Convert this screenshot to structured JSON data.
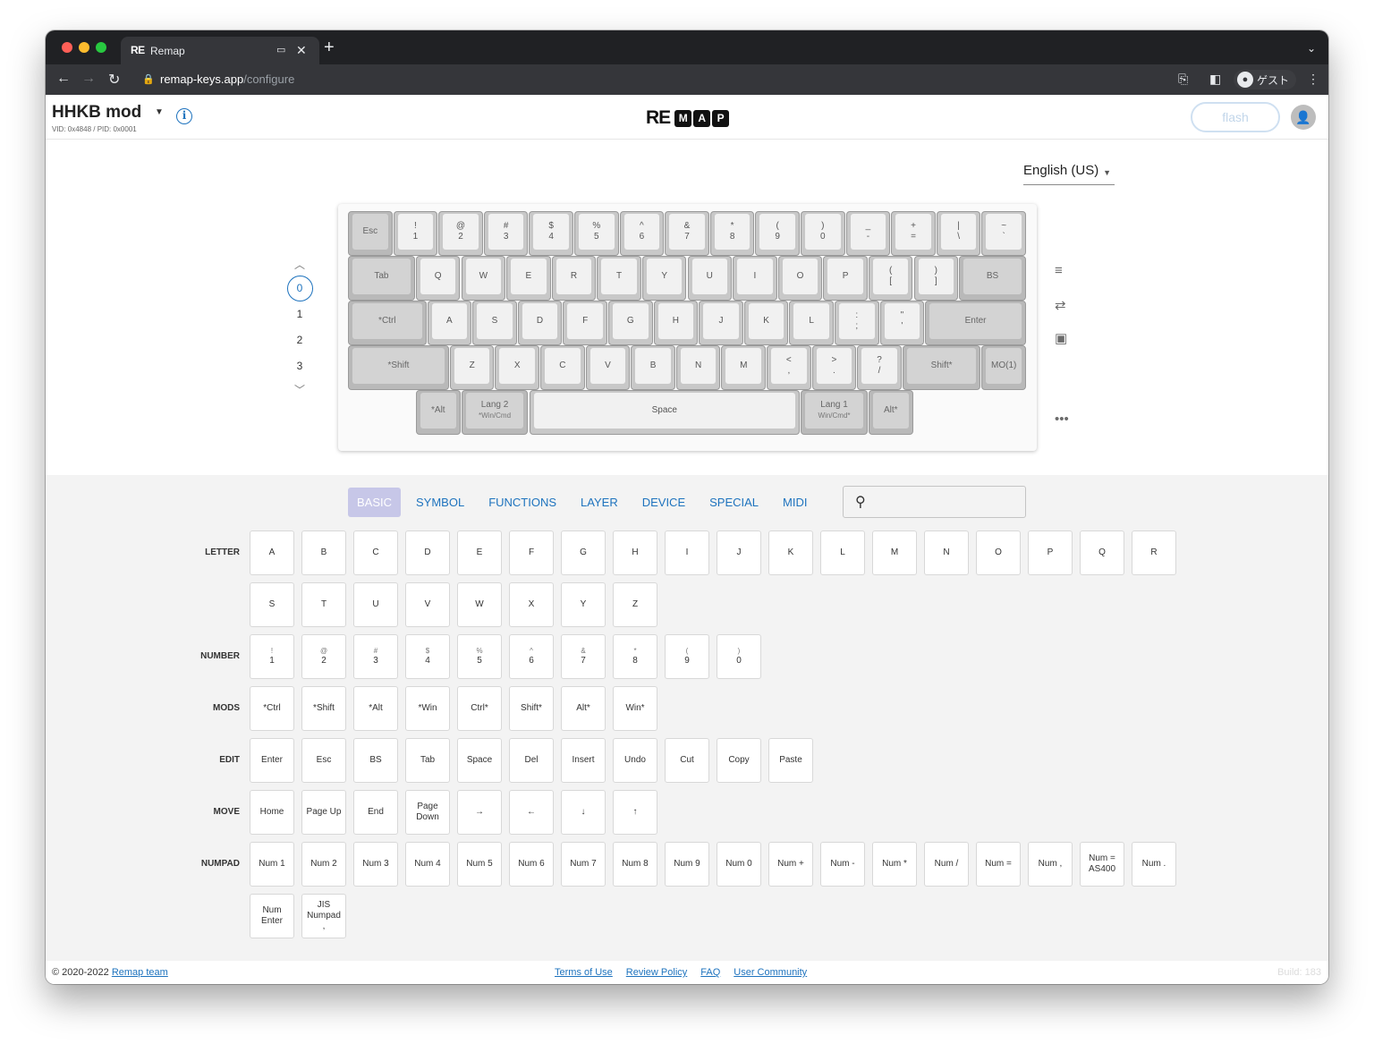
{
  "browser": {
    "tab_title": "Remap",
    "tab_favicon": "RE",
    "url_host": "remap-keys.app",
    "url_path": "/configure",
    "guest_label": "ゲスト",
    "traffic_colors": [
      "#ff5f57",
      "#febc2e",
      "#28c840"
    ]
  },
  "header": {
    "keyboard_name": "HHKB mod",
    "ids": "VID: 0x4848 / PID: 0x0001",
    "logo_re": "RE",
    "logo_letters": [
      "M",
      "A",
      "P"
    ],
    "flash_label": "flash"
  },
  "language": {
    "selected": "English (US)"
  },
  "layers": {
    "items": [
      "0",
      "1",
      "2",
      "3"
    ],
    "selected": "0"
  },
  "keyboard_keys": {
    "row1": [
      {
        "top": "",
        "main": "Esc",
        "mod": true
      },
      {
        "top": "!",
        "main": "1"
      },
      {
        "top": "@",
        "main": "2"
      },
      {
        "top": "#",
        "main": "3"
      },
      {
        "top": "$",
        "main": "4"
      },
      {
        "top": "%",
        "main": "5"
      },
      {
        "top": "^",
        "main": "6"
      },
      {
        "top": "&",
        "main": "7"
      },
      {
        "top": "*",
        "main": "8"
      },
      {
        "top": "(",
        "main": "9"
      },
      {
        "top": ")",
        "main": "0"
      },
      {
        "top": "_",
        "main": "-"
      },
      {
        "top": "+",
        "main": "="
      },
      {
        "top": "|",
        "main": "\\"
      },
      {
        "top": "~",
        "main": "`"
      }
    ],
    "row2": [
      {
        "main": "Tab",
        "mod": true
      },
      {
        "main": "Q"
      },
      {
        "main": "W"
      },
      {
        "main": "E"
      },
      {
        "main": "R"
      },
      {
        "main": "T"
      },
      {
        "main": "Y"
      },
      {
        "main": "U"
      },
      {
        "main": "I"
      },
      {
        "main": "O"
      },
      {
        "main": "P"
      },
      {
        "top": "(",
        "main": "["
      },
      {
        "top": ")",
        "main": "]"
      },
      {
        "main": "BS",
        "mod": true
      }
    ],
    "row3": [
      {
        "main": "*Ctrl",
        "mod": true
      },
      {
        "main": "A"
      },
      {
        "main": "S"
      },
      {
        "main": "D"
      },
      {
        "main": "F"
      },
      {
        "main": "G"
      },
      {
        "main": "H"
      },
      {
        "main": "J"
      },
      {
        "main": "K"
      },
      {
        "main": "L"
      },
      {
        "top": ":",
        "main": ";"
      },
      {
        "top": "\"",
        "main": "'"
      },
      {
        "main": "Enter",
        "mod": true
      }
    ],
    "row4": [
      {
        "main": "*Shift",
        "mod": true
      },
      {
        "main": "Z"
      },
      {
        "main": "X"
      },
      {
        "main": "C"
      },
      {
        "main": "V"
      },
      {
        "main": "B"
      },
      {
        "main": "N"
      },
      {
        "main": "M"
      },
      {
        "top": "<",
        "main": ","
      },
      {
        "top": ">",
        "main": "."
      },
      {
        "top": "?",
        "main": "/"
      },
      {
        "main": "Shift*",
        "mod": true
      },
      {
        "main": "MO(1)",
        "mod": true
      }
    ],
    "row5": [
      {
        "main": "*Alt",
        "mod": true
      },
      {
        "main": "Lang 2",
        "sub": "*Win/Cmd",
        "mod": true
      },
      {
        "main": "Space"
      },
      {
        "main": "Lang 1",
        "sub": "Win/Cmd*",
        "mod": true
      },
      {
        "main": "Alt*",
        "mod": true
      }
    ]
  },
  "categories": {
    "tabs": [
      "BASIC",
      "SYMBOL",
      "FUNCTIONS",
      "LAYER",
      "DEVICE",
      "SPECIAL",
      "MIDI"
    ],
    "active": "BASIC",
    "search_placeholder": ""
  },
  "keycode_rows": {
    "letter": {
      "label": "LETTER",
      "keys": [
        "A",
        "B",
        "C",
        "D",
        "E",
        "F",
        "G",
        "H",
        "I",
        "J",
        "K",
        "L",
        "M",
        "N",
        "O",
        "P",
        "Q",
        "R",
        "S",
        "T",
        "U",
        "V",
        "W",
        "X",
        "Y",
        "Z"
      ]
    },
    "number": {
      "label": "NUMBER",
      "keys": [
        {
          "s": "!",
          "m": "1"
        },
        {
          "s": "@",
          "m": "2"
        },
        {
          "s": "#",
          "m": "3"
        },
        {
          "s": "$",
          "m": "4"
        },
        {
          "s": "%",
          "m": "5"
        },
        {
          "s": "^",
          "m": "6"
        },
        {
          "s": "&",
          "m": "7"
        },
        {
          "s": "*",
          "m": "8"
        },
        {
          "s": "(",
          "m": "9"
        },
        {
          "s": ")",
          "m": "0"
        }
      ]
    },
    "mods": {
      "label": "MODS",
      "keys": [
        "*Ctrl",
        "*Shift",
        "*Alt",
        "*Win",
        "Ctrl*",
        "Shift*",
        "Alt*",
        "Win*"
      ]
    },
    "edit": {
      "label": "EDIT",
      "keys": [
        "Enter",
        "Esc",
        "BS",
        "Tab",
        "Space",
        "Del",
        "Insert",
        "Undo",
        "Cut",
        "Copy",
        "Paste"
      ]
    },
    "move": {
      "label": "MOVE",
      "keys": [
        "Home",
        "Page Up",
        "End",
        "Page Down",
        "→",
        "←",
        "↓",
        "↑"
      ]
    },
    "numpad": {
      "label": "NUMPAD",
      "keys": [
        "Num 1",
        "Num 2",
        "Num 3",
        "Num 4",
        "Num 5",
        "Num 6",
        "Num 7",
        "Num 8",
        "Num 9",
        "Num 0",
        "Num +",
        "Num -",
        "Num *",
        "Num /",
        "Num =",
        "Num ,",
        "Num = AS400",
        "Num .",
        "Num Enter",
        "JIS Numpad ,"
      ]
    }
  },
  "footer": {
    "copyright": "© 2020-2022",
    "team_link": "Remap team",
    "links": [
      "Terms of Use",
      "Review Policy",
      "FAQ",
      "User Community"
    ],
    "build": "Build: 183"
  }
}
